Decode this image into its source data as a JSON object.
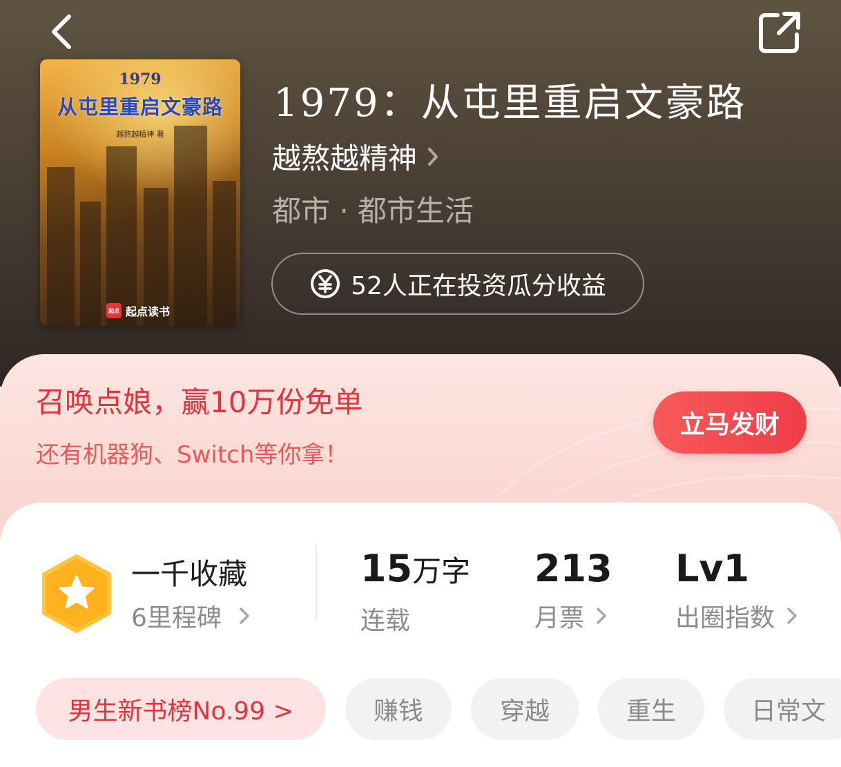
{
  "nav": {
    "back_icon": "chevron-left-icon",
    "share_icon": "share-external-icon"
  },
  "book": {
    "cover": {
      "year": "1979",
      "title": "从屯里重启文豪路",
      "author": "越熬越精神 著",
      "logo": "起点读书",
      "logo_mark": "起点"
    },
    "title": "1979：从屯里重启文豪路",
    "author": "越熬越精神",
    "genre": "都市 · 都市生活",
    "invest_text": "52人正在投资瓜分收益",
    "invest_icon": "yuan-coin-icon"
  },
  "promo": {
    "title": "召唤点娘，赢10万份免单",
    "subtitle": "还有机器狗、Switch等你拿！",
    "button": "立马发财",
    "accent": "#e3343c"
  },
  "stats": {
    "milestone": {
      "title": "一千收藏",
      "subtitle": "6里程碑",
      "icon": "star-hexagon-badge-icon"
    },
    "words": {
      "value": "15",
      "unit": "万字",
      "label": "连载"
    },
    "votes": {
      "value": "213",
      "label": "月票"
    },
    "index": {
      "value": "Lv1",
      "label": "出圈指数"
    }
  },
  "tags": {
    "rank": "男生新书榜No.99 >",
    "items": [
      "赚钱",
      "穿越",
      "重生",
      "日常文"
    ]
  }
}
